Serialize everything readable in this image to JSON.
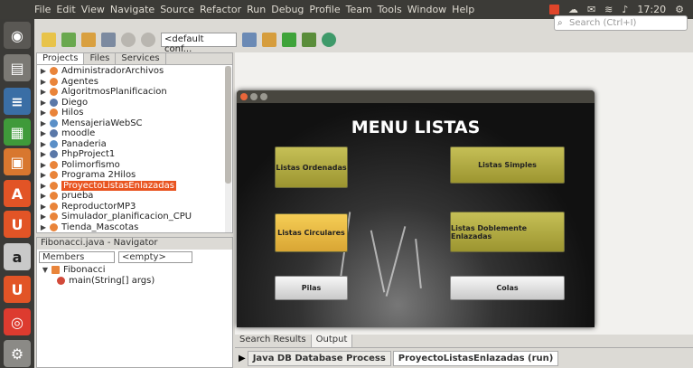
{
  "menubar": [
    "File",
    "Edit",
    "View",
    "Navigate",
    "Source",
    "Refactor",
    "Run",
    "Debug",
    "Profile",
    "Team",
    "Tools",
    "Window",
    "Help"
  ],
  "tray": {
    "time": "17:20"
  },
  "search": {
    "placeholder": "Search (Ctrl+I)"
  },
  "toolbar": {
    "config": "<default conf..."
  },
  "projects_panel": {
    "tabs": [
      "Projects",
      "Files",
      "Services"
    ],
    "items": [
      {
        "label": "AdministradorArchivos"
      },
      {
        "label": "Agentes"
      },
      {
        "label": "AlgoritmosPlanificacion"
      },
      {
        "label": "Diego"
      },
      {
        "label": "Hilos"
      },
      {
        "label": "MensajeriaWebSC"
      },
      {
        "label": "moodle"
      },
      {
        "label": "Panaderia"
      },
      {
        "label": "PhpProject1"
      },
      {
        "label": "Polimorfismo"
      },
      {
        "label": "Programa 2Hilos"
      },
      {
        "label": "ProyectoListasEnlazadas"
      },
      {
        "label": "prueba"
      },
      {
        "label": "ReproductorMP3"
      },
      {
        "label": "Simulador_planificacion_CPU"
      },
      {
        "label": "Tienda_Mascotas"
      }
    ]
  },
  "navigator": {
    "title": "Fibonacci.java - Navigator",
    "filter1": "Members",
    "filter2": "<empty>",
    "class_name": "Fibonacci",
    "method": "main(String[] args)"
  },
  "app_window": {
    "title": "MENU LISTAS",
    "buttons": {
      "ordenadas": "Listas Ordenadas",
      "simples": "Listas Simples",
      "circulares": "Listas Circulares",
      "doble": "Listas Doblemente Enlazadas",
      "pilas": "Pilas",
      "colas": "Colas"
    }
  },
  "bottom": {
    "tabs": [
      "Search Results",
      "Output"
    ],
    "processes": [
      "Java DB Database Process",
      "ProyectoListasEnlazadas (run)"
    ]
  },
  "colors": {
    "selection": "#e95420",
    "panel_bg": "#dcdad5"
  }
}
